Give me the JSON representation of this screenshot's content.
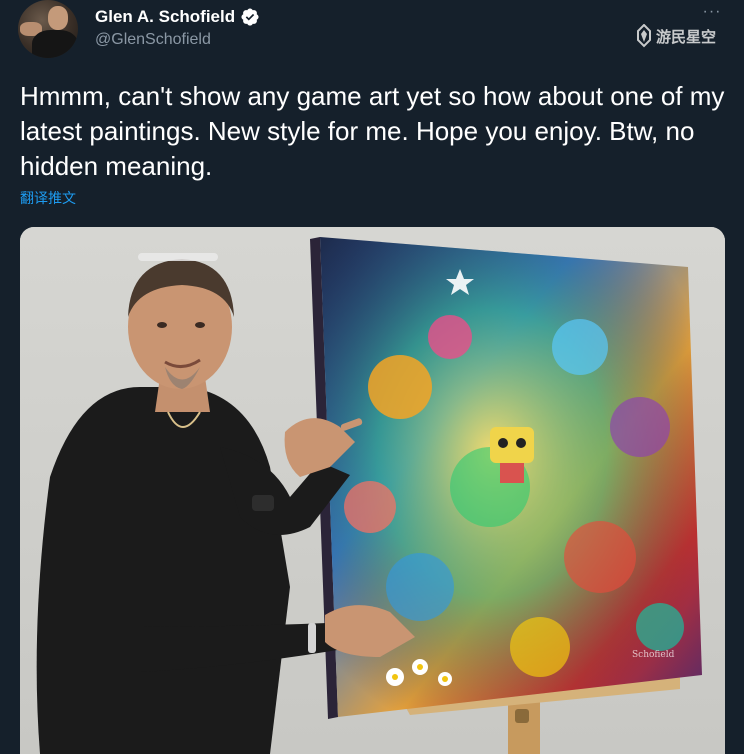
{
  "author": {
    "display_name": "Glen A. Schofield",
    "handle": "@GlenSchofield",
    "verified": true,
    "avatar_icon": "profile-photo"
  },
  "menu": {
    "more_label": "···",
    "icon": "more-horizontal-icon"
  },
  "watermark": {
    "text": "游民星空",
    "icon": "gamersky-logo-icon"
  },
  "tweet": {
    "text": "Hmmm, can't show any game art yet so how about one of my latest paintings. New style for me. Hope you enjoy. Btw, no hidden meaning.",
    "translate_label": "翻译推文"
  },
  "media": {
    "type": "photo",
    "subject": "man-presenting-painting",
    "painting_signature": "Schofield"
  },
  "colors": {
    "background": "#15202b",
    "text_primary": "#ffffff",
    "text_secondary": "#8b98a5",
    "link": "#1d9bf0",
    "verified": "#ffffff"
  }
}
